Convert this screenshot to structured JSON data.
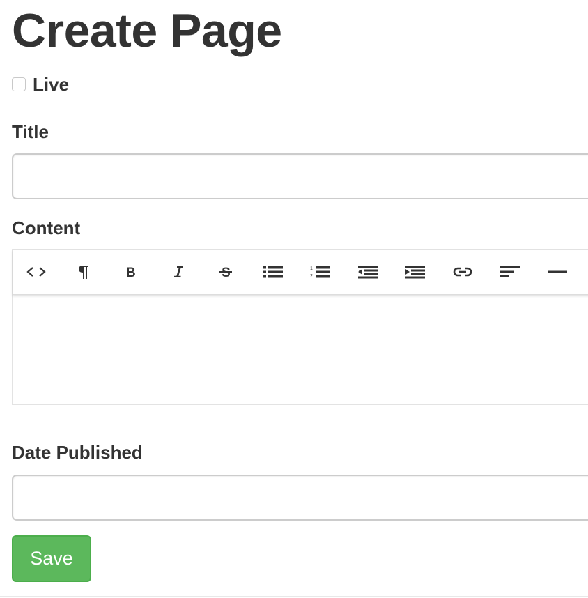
{
  "page": {
    "title": "Create Page"
  },
  "form": {
    "live_label": "Live",
    "live_checked": false,
    "title_label": "Title",
    "title_value": "",
    "content_label": "Content",
    "content_value": "",
    "date_published_label": "Date Published",
    "date_published_value": "",
    "save_label": "Save"
  },
  "toolbar": {
    "buttons": [
      {
        "name": "code-view-button",
        "icon": "code-icon"
      },
      {
        "name": "paragraph-button",
        "icon": "pilcrow-icon"
      },
      {
        "name": "bold-button",
        "icon": "bold-icon"
      },
      {
        "name": "italic-button",
        "icon": "italic-icon"
      },
      {
        "name": "strikethrough-button",
        "icon": "strikethrough-icon"
      },
      {
        "name": "bullet-list-button",
        "icon": "unordered-list-icon"
      },
      {
        "name": "numbered-list-button",
        "icon": "ordered-list-icon"
      },
      {
        "name": "outdent-button",
        "icon": "outdent-icon"
      },
      {
        "name": "indent-button",
        "icon": "indent-icon"
      },
      {
        "name": "link-button",
        "icon": "link-icon"
      },
      {
        "name": "align-button",
        "icon": "align-left-icon"
      },
      {
        "name": "horizontal-rule-button",
        "icon": "horizontal-rule-icon"
      }
    ]
  },
  "colors": {
    "text": "#333333",
    "save_button": "#5cb85c",
    "save_button_border": "#4cae4c",
    "input_border": "#cccccc"
  }
}
